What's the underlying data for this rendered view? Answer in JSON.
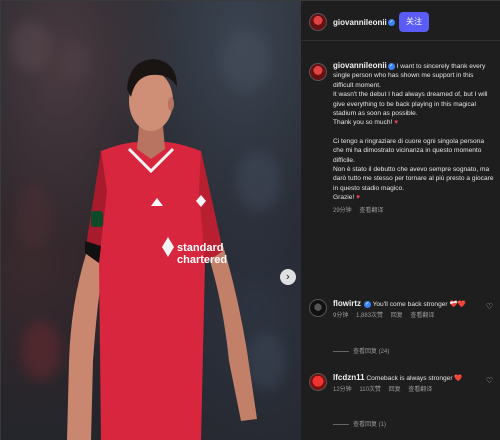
{
  "post": {
    "username": "giovannileonii",
    "follow_label": "关注",
    "more_icon": "ellipsis-icon",
    "caption": {
      "username": "giovannileonii",
      "en_line1": "I want to sincerely thank every single person who has shown me support in this difficult moment.",
      "en_line2": "It wasn't the debut I had always dreamed of, but I will give everything to be back playing in this magical stadium as soon as possible.",
      "en_line3": "Thank you so much!",
      "it_line1": "Ci tengo a ringraziare di cuore ogni singola persona che mi ha dimostrato vicinanza in questo momento difficile.",
      "it_line2": "Non è stato il debutto che avevo sempre sognato, ma darò tutto me stesso per tornare al più presto a giocare in questo stadio magico.",
      "it_line3": "Grazie!",
      "time": "29分钟",
      "translate": "查看翻译"
    }
  },
  "comments": [
    {
      "username": "flowirtz",
      "text": "You'll come back stronger",
      "emoji": "❤️‍🩹❤️",
      "time": "9分钟",
      "likes": "1,883次赞",
      "reply": "回复",
      "translate": "查看翻译",
      "replies": "查看回复 (24)"
    },
    {
      "username": "lfcdzn11",
      "text": "Comeback is always stronger",
      "emoji": "❤️",
      "time": "12分钟",
      "likes": "110次赞",
      "reply": "回复",
      "translate": "查看翻译",
      "replies": "查看回复 (1)"
    }
  ],
  "photo": {
    "sponsor_line1": "standard",
    "sponsor_line2": "chartered",
    "next_icon": "chevron-right-icon"
  },
  "colors": {
    "follow": "#5b5bf5",
    "verified": "#3b82f6",
    "heart": "#e5484d",
    "kit": "#d7263d"
  }
}
